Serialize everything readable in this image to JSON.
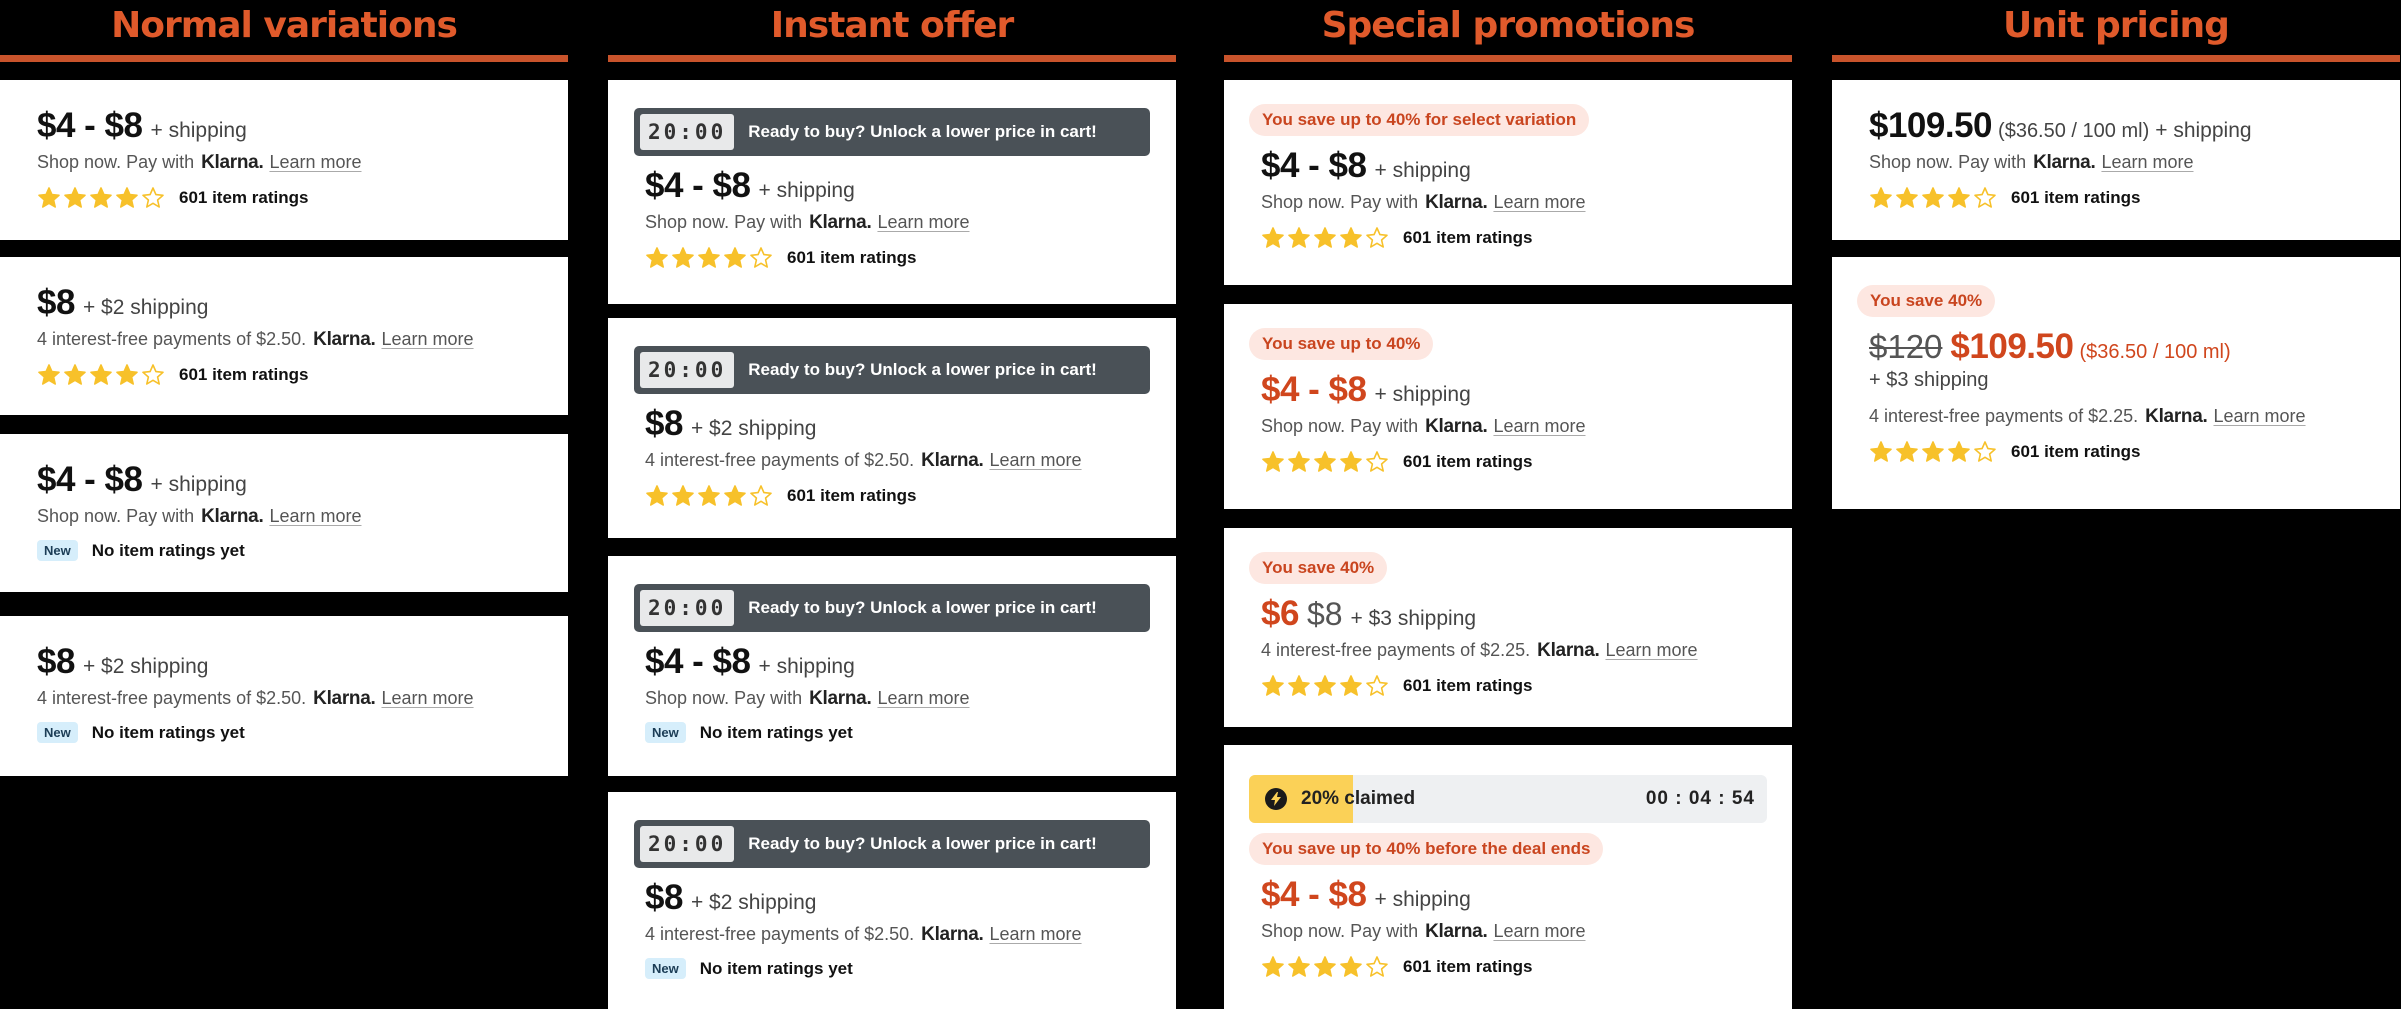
{
  "columns": [
    {
      "title": "Normal variations"
    },
    {
      "title": "Instant offer"
    },
    {
      "title": "Special promotions"
    },
    {
      "title": "Unit pricing"
    }
  ],
  "common": {
    "shipping": "+ shipping",
    "shipping_2": "+ $2 shipping",
    "shipping_3": "+ $3 shipping",
    "pay_shop": "Shop now. Pay with",
    "pay_interest_250": "4 interest-free payments of $2.50.",
    "pay_interest_225": "4 interest-free payments of $2.25.",
    "klarna": "Klarna.",
    "learn_more": "Learn more",
    "ratings": "601 item ratings",
    "no_ratings": "No item ratings yet",
    "new_badge": "New",
    "star_rating": 4,
    "star_max": 5
  },
  "prices": {
    "range": "$4 - $8",
    "eight": "$8",
    "six": "$6",
    "p10950": "$109.50",
    "p120": "$120",
    "unit": "($36.50 / 100 ml)"
  },
  "instant": {
    "timer": "20:00",
    "message": "Ready to buy? Unlock a lower price in cart!"
  },
  "promos": {
    "save_select": "You save up to 40% for select variation",
    "save_upto": "You save up to 40%",
    "save_40": "You save 40%",
    "save_deal": "You save up to 40% before the deal ends",
    "claimed": "20% claimed",
    "claimed_fraction": 0.2,
    "countdown": "00 : 04 : 54"
  },
  "colors": {
    "accent": "#d0461d",
    "star": "#f7c12a",
    "timer_bg": "#4a5157"
  }
}
